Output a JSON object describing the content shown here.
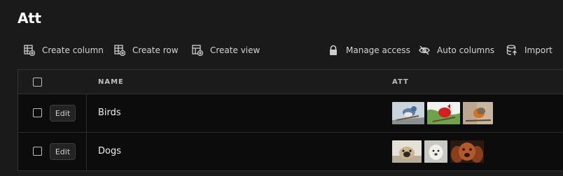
{
  "page": {
    "title": "Att"
  },
  "toolbar": {
    "create_column": "Create column",
    "create_row": "Create row",
    "create_view": "Create view",
    "manage_access": "Manage access",
    "auto_columns": "Auto columns",
    "import": "Import"
  },
  "table": {
    "columns": [
      "NAME",
      "ATT"
    ],
    "edit_label": "Edit",
    "rows": [
      {
        "name": "Birds",
        "attachments": [
          "blue-bird-photo",
          "red-cardinal-photo",
          "robin-photo"
        ]
      },
      {
        "name": "Dogs",
        "attachments": [
          "pug-photo",
          "white-dog-photo",
          "spaniel-photo"
        ]
      }
    ]
  },
  "colors": {
    "background": "#1a1a1a",
    "table_body": "#0c0c0c",
    "header_row": "#1b1b1b",
    "border": "#333333",
    "text": "#e6e6e6"
  }
}
